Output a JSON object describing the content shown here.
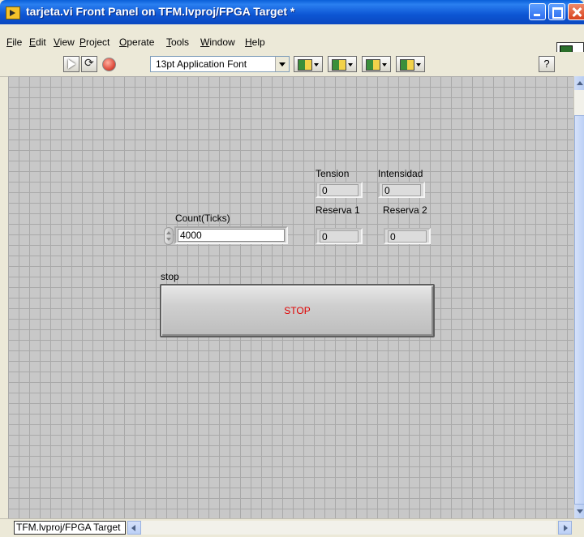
{
  "window": {
    "title": "tarjeta.vi Front Panel on TFM.lvproj/FPGA Target *"
  },
  "menu": {
    "items": [
      "File",
      "Edit",
      "View",
      "Project",
      "Operate",
      "Tools",
      "Window",
      "Help"
    ]
  },
  "toolbar": {
    "font": "13pt Application Font",
    "help": "?"
  },
  "panel": {
    "indicators": [
      {
        "label": "Tension",
        "value": "0"
      },
      {
        "label": "Intensidad",
        "value": "0"
      },
      {
        "label": "Reserva 1",
        "value": "0"
      },
      {
        "label": "Reserva 2",
        "value": "0"
      }
    ],
    "count": {
      "label": "Count(Ticks)",
      "value": "4000"
    },
    "stop": {
      "label": "stop",
      "text": "STOP"
    }
  },
  "status": {
    "target": "TFM.lvproj/FPGA Target"
  },
  "colors": {
    "titlebar": "#0a5fd8",
    "panel_bg": "#c8c8c8",
    "grid": "#a9a9a9",
    "stop_text": "#e00000"
  }
}
